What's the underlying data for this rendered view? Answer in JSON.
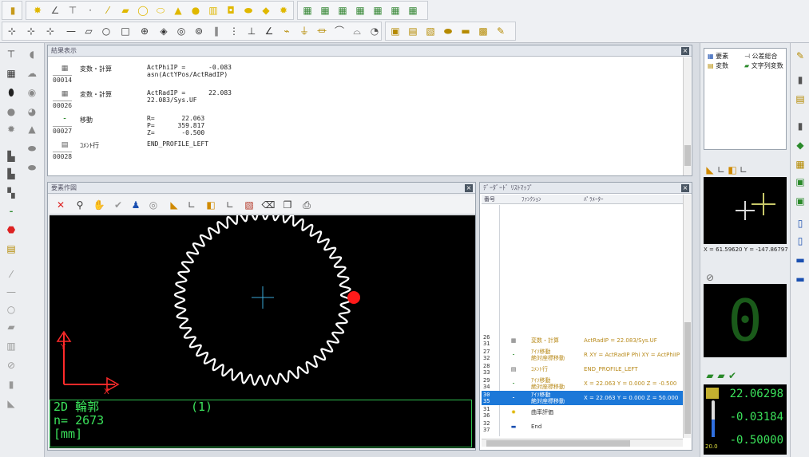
{
  "result_panel": {
    "title": "結果表示",
    "rows": [
      {
        "num": "00014",
        "name": "変数・計算",
        "code": "ActPhiIP =      -0.083\nasn(ActYPos/ActRadIP)"
      },
      {
        "num": "00026",
        "name": "変数・計算",
        "code": "ActRadIP =      22.083\n22.083/Sys.UF"
      },
      {
        "num": "00027",
        "name": "移動",
        "code": "R=       22.063\nP=      359.817\nZ=       -0.500"
      },
      {
        "num": "00028",
        "name": "ｺﾒﾝﾄ行",
        "code": "END_PROFILE_LEFT"
      }
    ]
  },
  "draw_panel": {
    "title": "要素作図",
    "info_line1": "2D 輪郭",
    "info_index": "(1)",
    "info_line2": "n= 2673",
    "info_line3": "[mm]",
    "axis_y": "Y",
    "axis_x": "X"
  },
  "list_panel": {
    "title": "ﾃﾞｰﾀﾞｰﾄﾞ ﾘｽﾄﾏｯﾌﾟ",
    "col_num": "番号",
    "col_func": "ﾌｧﾝｸｼｮﾝ",
    "col_param": "ﾊﾟﾗﾒｰﾀｰ",
    "rows": [
      {
        "n1": "26",
        "n2": "31",
        "func": "変数・計算",
        "param": "ActRadIP      = 22.083/Sys.UF"
      },
      {
        "n1": "27",
        "n2": "32",
        "func": "ｱｲｿ移動\n絶対座標移動",
        "param": "R XY = ActRadIP  Phi XY = ActPhiIP"
      },
      {
        "n1": "28",
        "n2": "33",
        "func": "ｺﾒﾝﾄ行",
        "param": "END_PROFILE_LEFT"
      },
      {
        "n1": "29",
        "n2": "34",
        "func": "ｱｲｿ移動\n絶対座標移動",
        "param": "X = 22.063  Y = 0.000  Z = -0.500"
      },
      {
        "n1": "30",
        "n2": "35",
        "func": "ｱｲｿ移動\n絶対座標移動",
        "param": "X = 22.063  Y = 0.000  Z = 50.000"
      },
      {
        "n1": "31",
        "n2": "36",
        "func": "曲率評価",
        "param": ""
      },
      {
        "n1": "32",
        "n2": "37",
        "func": "End",
        "param": ""
      }
    ]
  },
  "right_panel": {
    "tab_elements": "要素",
    "tab_tolerance": "公差総合",
    "tab_variables": "変数",
    "tab_string_vars": "文字列変数",
    "coords": "X = 61.59620 Y = -147.86797 Z =",
    "big_digit": "0",
    "readout_x": "22.06298",
    "readout_y": "-0.03184",
    "readout_z": "-0.50000",
    "temp": "20.0"
  },
  "colors": {
    "accent": "#1c78d8",
    "green": "#3be35b",
    "probe": "#ff1a1a"
  }
}
